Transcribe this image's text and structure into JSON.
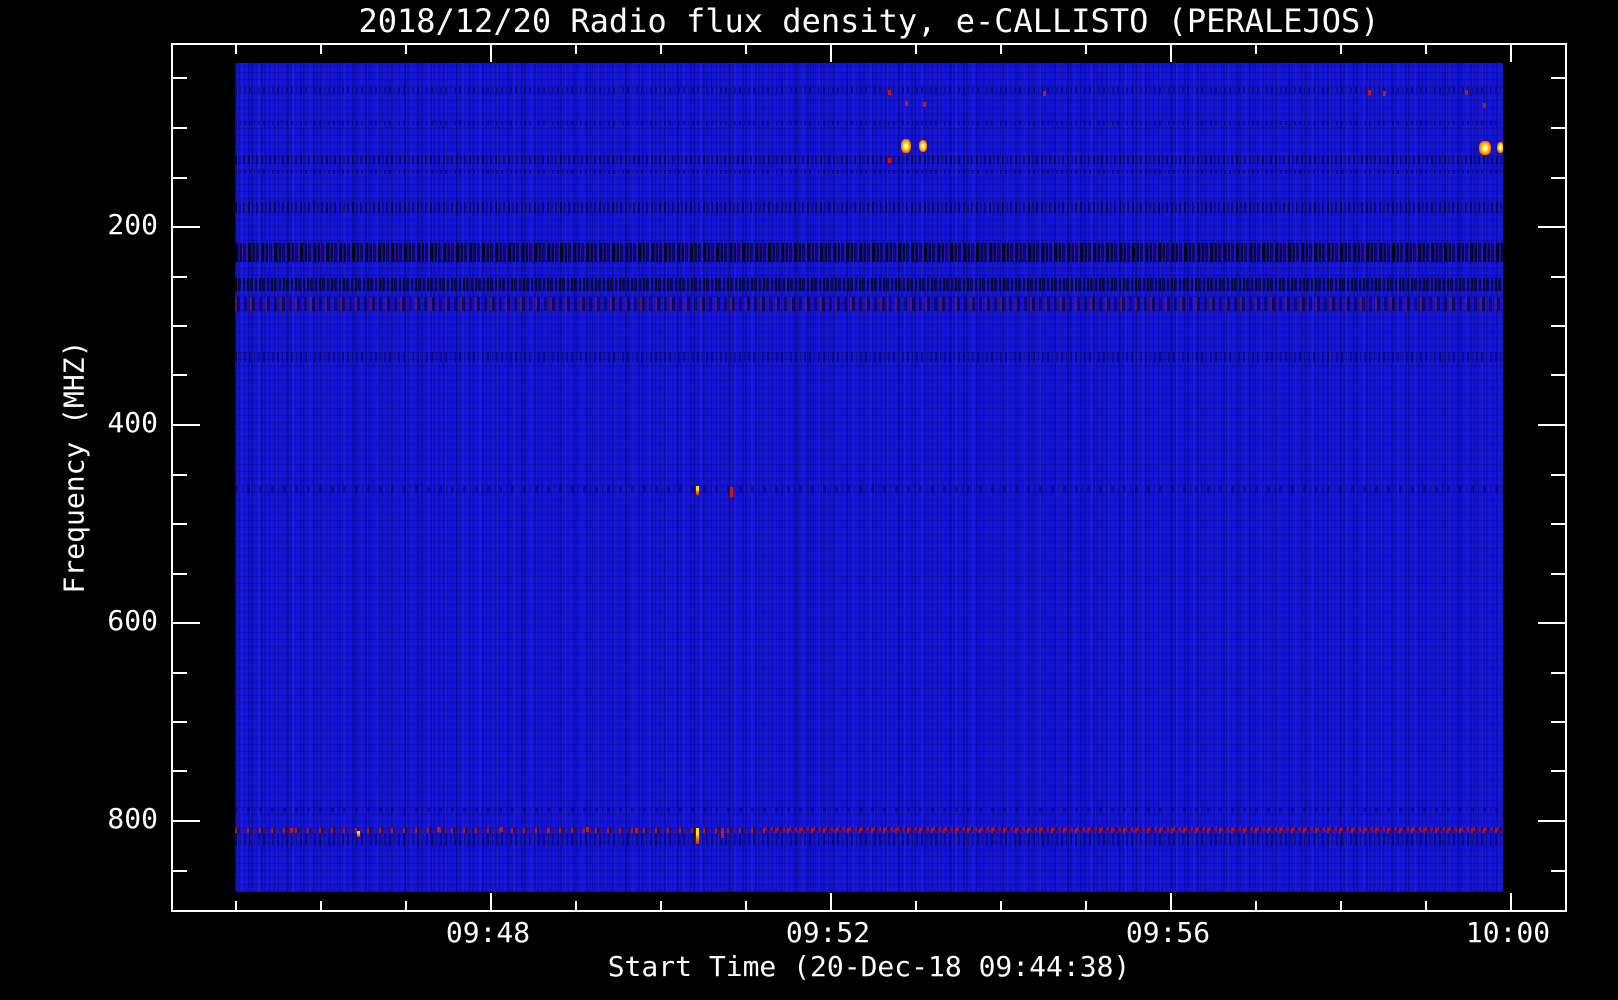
{
  "title": "2018/12/20  Radio flux density, e-CALLISTO (PERALEJOS)",
  "axes": {
    "x": {
      "label": "Start Time (20-Dec-18 09:44:38)",
      "ticks": [
        "09:48",
        "09:52",
        "09:56",
        "10:00"
      ]
    },
    "y": {
      "label": "Frequency (MHZ)",
      "ticks": [
        "200",
        "400",
        "600",
        "800"
      ]
    }
  },
  "chart_data": {
    "type": "heatmap",
    "subtype": "radio-spectrogram",
    "title": "2018/12/20  Radio flux density, e-CALLISTO (PERALEJOS)",
    "instrument": "e-CALLISTO (PERALEJOS)",
    "date": "2018/12/20",
    "xlabel": "Start Time (20-Dec-18 09:44:38)",
    "ylabel": "Frequency (MHZ)",
    "x_tick_labels": [
      "09:48",
      "09:52",
      "09:56",
      "10:00"
    ],
    "x_minor_tick_interval": "1 minute",
    "x_range": [
      "09:44:38",
      "10:00:00"
    ],
    "y_tick_values_mhz": [
      200,
      400,
      600,
      800
    ],
    "y_minor_tick_interval_mhz": 50,
    "y_range_mhz": [
      40,
      875
    ],
    "y_axis_direction": "frequency increases downward",
    "grid": "off",
    "legend": "none",
    "background_flux": "uniform low-level blue noise with vertical streak texture",
    "colormap_description": "blue = low flux, black = below background, red/orange/yellow/white = increasing flux",
    "interference_bands": [
      {
        "freq_mhz": 65,
        "strength": "weak",
        "note": "dark speckled row with sparse red dots"
      },
      {
        "freq_mhz": 98,
        "strength": "weak",
        "note": "thin dark row with red speckles"
      },
      {
        "freq_mhz": 135,
        "strength": "medium",
        "note": "dark band"
      },
      {
        "freq_mhz": 147,
        "strength": "weak",
        "note": "thin dark row"
      },
      {
        "freq_mhz": 185,
        "strength": "medium",
        "note": "dark speckled band"
      },
      {
        "freq_mhz": 225,
        "strength": "strong",
        "note": "near-black dashed band with red speckles"
      },
      {
        "freq_mhz": 262,
        "strength": "strong",
        "note": "dark band with purple speckles"
      },
      {
        "freq_mhz": 281,
        "strength": "medium",
        "note": "dark band with red speckles"
      },
      {
        "freq_mhz": 335,
        "strength": "weak",
        "note": "faint dark band"
      },
      {
        "freq_mhz": 468,
        "strength": "very weak",
        "note": "faint intermittent dark line"
      },
      {
        "freq_mhz": 810,
        "strength": "weak",
        "note": "faint dark line"
      },
      {
        "freq_mhz": 813,
        "strength": "medium",
        "note": "red-speckled interference line across full width, denser purple speckles on right half, slight dark band below"
      }
    ],
    "bursts": [
      {
        "time": "09:52:55",
        "freq_mhz": 120,
        "intensity": "very bright point (white/yellow core, orange halo)"
      },
      {
        "time": "09:53:07",
        "freq_mhz": 120,
        "intensity": "bright point (yellow/orange)"
      },
      {
        "time": "09:59:40",
        "freq_mhz": 121,
        "intensity": "bright orange/yellow cluster"
      },
      {
        "time": "09:59:53",
        "freq_mhz": 121,
        "intensity": "bright orange point at right edge"
      },
      {
        "time": "09:50:28",
        "freq_mhz": 468,
        "intensity": "small yellow point"
      },
      {
        "time": "09:50:52",
        "freq_mhz": 470,
        "intensity": "small red dash"
      },
      {
        "time": "09:50:28",
        "freq_mhz": 813,
        "intensity": "bright yellow vertical dash"
      },
      {
        "time": "09:50:46",
        "freq_mhz": 815,
        "intensity": "red vertical dash"
      },
      {
        "time": "09:52:43",
        "freq_mhz": 67,
        "intensity": "red dot"
      },
      {
        "time": "09:54:32",
        "freq_mhz": 67,
        "intensity": "red dot"
      },
      {
        "time": "09:58:22",
        "freq_mhz": 67,
        "intensity": "red dot"
      },
      {
        "time": "09:58:33",
        "freq_mhz": 67,
        "intensity": "red dot"
      },
      {
        "time": "09:59:30",
        "freq_mhz": 67,
        "intensity": "red dot"
      }
    ]
  },
  "colors": {
    "background": "#000000",
    "axis": "#ffffff",
    "text": "#ffffff",
    "flux_base": "#1414d8",
    "burst_core": "#ffffff",
    "burst_mid": "#ffe000",
    "burst_halo": "#ff8800",
    "rfi_red": "#cf1408",
    "rfi_purple": "#aa0066"
  }
}
